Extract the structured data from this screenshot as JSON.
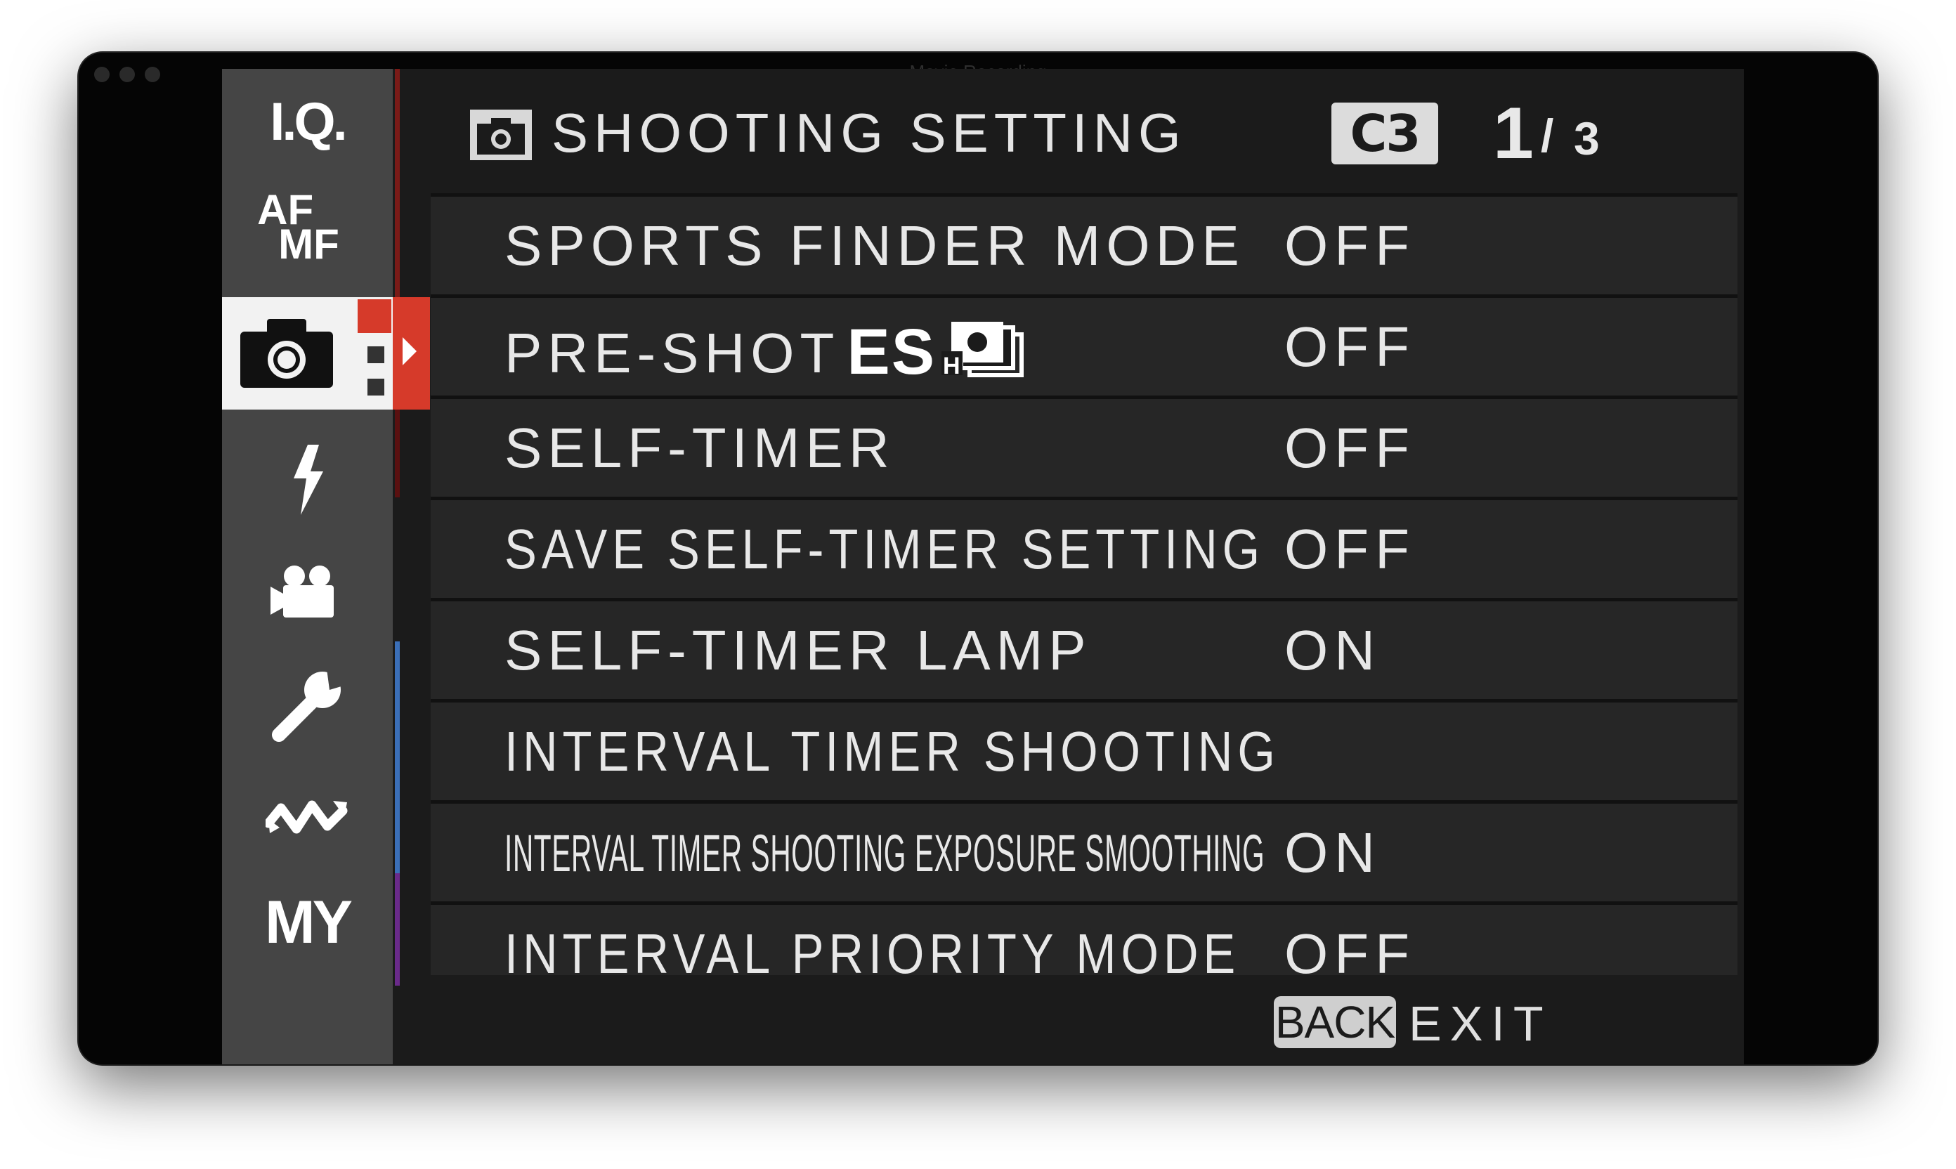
{
  "window": {
    "title": "Movie Recording"
  },
  "sidebar": {
    "items": [
      {
        "label": "I.Q.",
        "icon": "image-quality-icon"
      },
      {
        "label": "AF MF",
        "icon": "af-mf-icon"
      },
      {
        "icon": "camera-icon",
        "selected": true
      },
      {
        "icon": "flash-icon"
      },
      {
        "icon": "movie-camera-icon"
      },
      {
        "icon": "wrench-icon"
      },
      {
        "icon": "wireless-icon"
      },
      {
        "label": "MY",
        "icon": "my-menu-icon"
      }
    ],
    "af_top": "AF",
    "af_bottom": "MF"
  },
  "header": {
    "title": "SHOOTING SETTING",
    "custom_set": "C3",
    "page_current": "1",
    "page_separator": "/",
    "page_total": "3"
  },
  "menu": {
    "items": [
      {
        "label": "SPORTS FINDER MODE",
        "value": "OFF"
      },
      {
        "label": "PRE-SHOT",
        "label_suffix": "ES",
        "value": "OFF"
      },
      {
        "label": "SELF-TIMER",
        "value": "OFF"
      },
      {
        "label": "SAVE SELF-TIMER SETTING",
        "value": "OFF"
      },
      {
        "label": "SELF-TIMER LAMP",
        "value": "ON"
      },
      {
        "label": "INTERVAL TIMER SHOOTING",
        "value": ""
      },
      {
        "label": "INTERVAL TIMER SHOOTING EXPOSURE SMOOTHING",
        "value": "ON"
      },
      {
        "label": "INTERVAL PRIORITY MODE",
        "value": "OFF"
      }
    ]
  },
  "footer": {
    "back_label": "BACK",
    "exit_label": "EXIT"
  },
  "colors": {
    "accent": "#d63a2a",
    "sidebar_bg": "#454545",
    "row_bg": "#262626",
    "text": "#e8e8e8"
  }
}
